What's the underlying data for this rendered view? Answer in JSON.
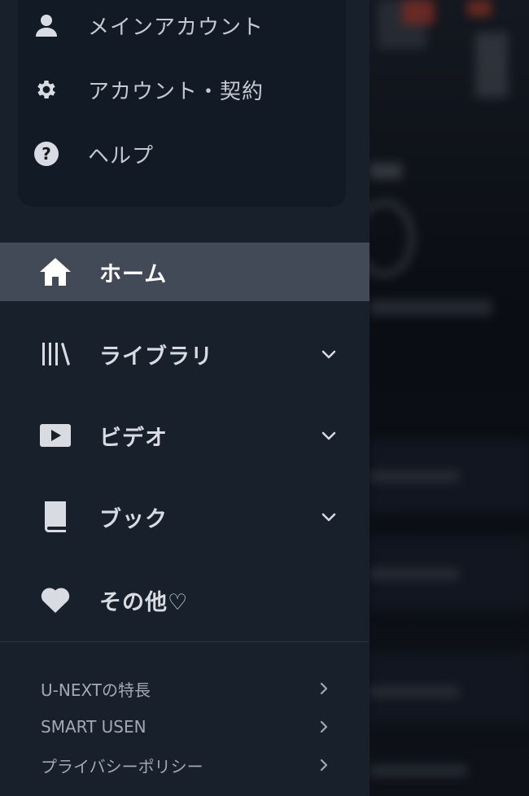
{
  "account_menu": {
    "items": [
      {
        "label": "メインアカウント",
        "icon": "user-icon"
      },
      {
        "label": "アカウント・契約",
        "icon": "gear-icon"
      },
      {
        "label": "ヘルプ",
        "icon": "help-icon"
      }
    ]
  },
  "nav": {
    "items": [
      {
        "label": "ホーム",
        "icon": "home-icon",
        "active": true,
        "expandable": false
      },
      {
        "label": "ライブラリ",
        "icon": "library-icon",
        "active": false,
        "expandable": true
      },
      {
        "label": "ビデオ",
        "icon": "video-play-icon",
        "active": false,
        "expandable": true
      },
      {
        "label": "ブック",
        "icon": "book-icon",
        "active": false,
        "expandable": true
      },
      {
        "label": "その他♡",
        "icon": "heart-icon",
        "active": false,
        "expandable": false
      }
    ]
  },
  "footer": {
    "links": [
      {
        "label": "U-NEXTの特長"
      },
      {
        "label": "SMART USEN"
      },
      {
        "label": "プライバシーポリシー"
      }
    ]
  },
  "colors": {
    "sidebar_bg": "#18202c",
    "card_bg": "#121a25",
    "active_bg": "#424a58",
    "icon": "#d8dce2"
  }
}
